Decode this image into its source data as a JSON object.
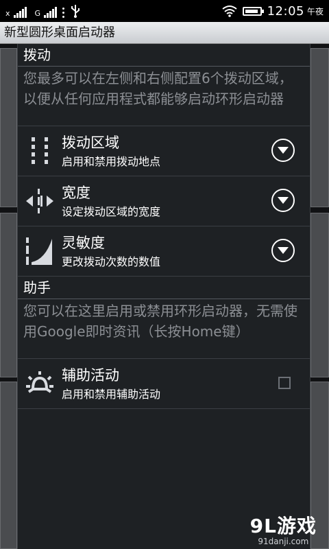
{
  "status_bar": {
    "sim1_label": "x",
    "sim2_label": "G",
    "time": "12:05",
    "period": "午夜",
    "battery_level": 0.9,
    "icons": [
      "signal-icon",
      "signal-icon",
      "usb-icon",
      "wifi-icon",
      "battery-icon"
    ]
  },
  "app": {
    "title": "新型圆形桌面启动器"
  },
  "sections": [
    {
      "header": "拨动",
      "description": "您最多可以在左侧和右侧配置6个拨动区域，以便从任何应用程式都能够启动环形启动器",
      "prefs": [
        {
          "title": "拨动区域",
          "summary": "启用和禁用拨动地点",
          "icon": "swipe-zones-icon",
          "widget": "dropdown"
        },
        {
          "title": "宽度",
          "summary": "设定拨动区域的宽度",
          "icon": "width-icon",
          "widget": "dropdown"
        },
        {
          "title": "灵敏度",
          "summary": "更改拨动次数的数值",
          "icon": "sensitivity-icon",
          "widget": "dropdown"
        }
      ]
    },
    {
      "header": "助手",
      "description": "您可以在这里启用或禁用环形启动器，无需使用Google即时资讯（长按Home键）",
      "prefs": [
        {
          "title": "辅助活动",
          "summary": "启用和禁用辅助活动",
          "icon": "assist-icon",
          "widget": "checkbox",
          "checked": false
        }
      ]
    }
  ],
  "watermark": {
    "brand": "9L游戏",
    "site": "91danji.com"
  },
  "colors": {
    "panel": "#1e2124",
    "desc_text": "#8c8f94",
    "background": "#111214"
  }
}
